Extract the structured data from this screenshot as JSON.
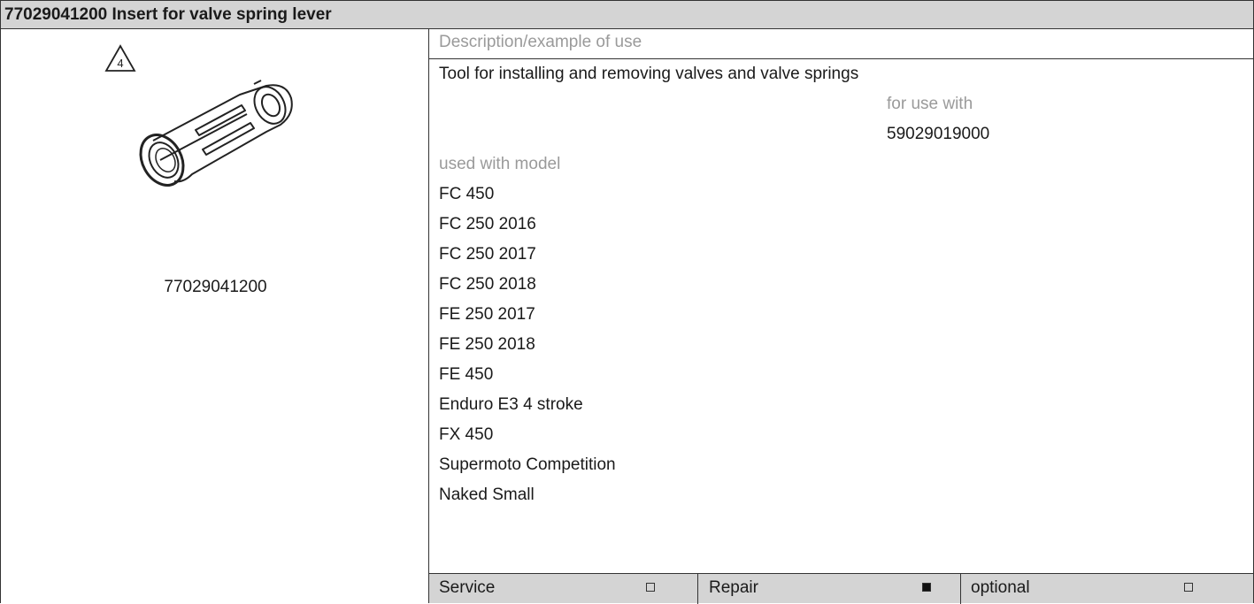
{
  "title": "77029041200 Insert for valve spring lever",
  "warning_number": "4",
  "part_number": "77029041200",
  "description_label": "Description/example of use",
  "description": "Tool for installing and removing valves and valve springs",
  "for_use_with_label": "for use with",
  "for_use_with_value": "59029019000",
  "used_with_model_label": "used with model",
  "models": [
    "FC 450",
    "FC 250 2016",
    "FC 250 2017",
    "FC 250 2018",
    "FE 250 2017",
    "FE 250 2018",
    "FE 450",
    "Enduro E3 4 stroke",
    "FX 450",
    "Supermoto Competition",
    "Naked Small"
  ],
  "footer": {
    "service_label": "Service",
    "service_checked": false,
    "repair_label": "Repair",
    "repair_checked": true,
    "optional_label": "optional",
    "optional_checked": false
  }
}
